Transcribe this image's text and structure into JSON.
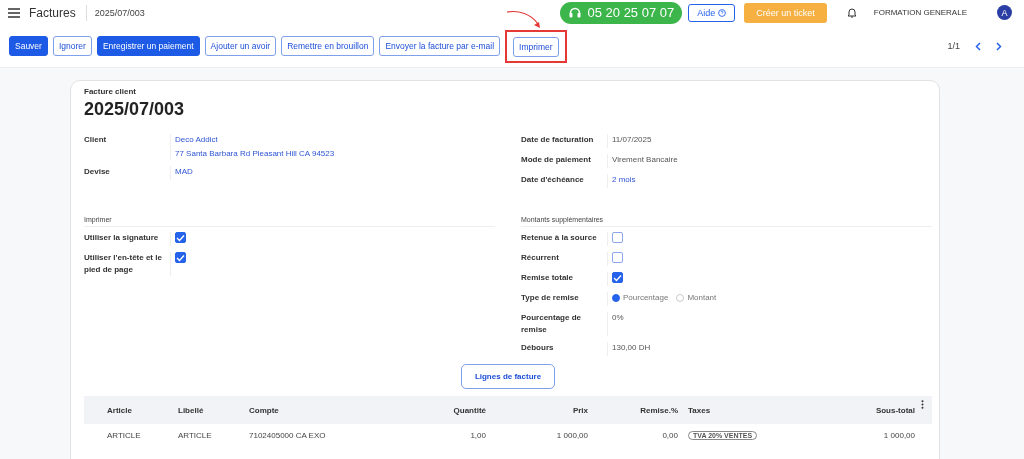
{
  "header": {
    "app": "Factures",
    "record": "2025/07/003",
    "phone": "05 20 25 07 07",
    "help": "Aide",
    "ticket": "Créer un ticket",
    "company": "FORMATION GENERALE",
    "avatar": "A"
  },
  "actions": [
    {
      "label": "Sauver",
      "primary": true,
      "highlighted": false
    },
    {
      "label": "Ignorer",
      "primary": false,
      "highlighted": false
    },
    {
      "label": "Enregistrer un paiement",
      "primary": true,
      "highlighted": false
    },
    {
      "label": "Ajouter un avoir",
      "primary": false,
      "highlighted": false
    },
    {
      "label": "Remettre en brouillon",
      "primary": false,
      "highlighted": false
    },
    {
      "label": "Envoyer la facture par e-mail",
      "primary": false,
      "highlighted": false
    },
    {
      "label": "Imprimer",
      "primary": false,
      "highlighted": true
    }
  ],
  "pager": "1/1",
  "form": {
    "subtitle": "Facture client",
    "title": "2025/07/003",
    "left_fields": [
      {
        "label": "Client",
        "values": [
          "Deco Addict",
          "77 Santa Barbara Rd Pleasant Hill CA 94523"
        ],
        "link": true
      },
      {
        "label": "Devise",
        "values": [
          "MAD"
        ],
        "link": true
      }
    ],
    "right_fields": [
      {
        "label": "Date de facturation",
        "values": [
          "11/07/2025"
        ],
        "link": false
      },
      {
        "label": "Mode de paiement",
        "values": [
          "Virement Bancaire"
        ],
        "link": false
      },
      {
        "label": "Date d'échéance",
        "values": [
          "2 mois"
        ],
        "link": true
      }
    ],
    "print_section": {
      "title": "Imprimer",
      "rows": [
        {
          "label": "Utiliser la signature",
          "kind": "checkbox",
          "checked": true
        },
        {
          "label": "Utiliser l'en-tête et le pied de page",
          "kind": "checkbox",
          "checked": true
        }
      ]
    },
    "amounts_section": {
      "title": "Montants supplémentaires",
      "rows": [
        {
          "label": "Retenue à la source",
          "kind": "checkbox",
          "checked": false
        },
        {
          "label": "Récurrent",
          "kind": "checkbox",
          "checked": false
        },
        {
          "label": "Remise totale",
          "kind": "checkbox",
          "checked": true
        },
        {
          "label": "Type de remise",
          "kind": "radio",
          "options": [
            {
              "label": "Pourcentage",
              "selected": true
            },
            {
              "label": "Montant",
              "selected": false
            }
          ]
        },
        {
          "label": "Pourcentage de remise",
          "kind": "text",
          "value": "0%"
        },
        {
          "label": "Débours",
          "kind": "text",
          "value": "130,00 DH"
        }
      ]
    },
    "lines_button": "Lignes de facture",
    "table": {
      "columns": [
        {
          "label": "Article"
        },
        {
          "label": "Libellé"
        },
        {
          "label": "Compte"
        },
        {
          "label": "Quantité"
        },
        {
          "label": "Prix"
        },
        {
          "label": "Remise.%"
        },
        {
          "label": "Taxes"
        },
        {
          "label": "Sous-total"
        }
      ],
      "rows": [
        {
          "cells": [
            {
              "kind": "text",
              "text": "ARTICLE"
            },
            {
              "kind": "text",
              "text": "ARTICLE"
            },
            {
              "kind": "text",
              "text": "7102405000 CA EXO"
            },
            {
              "kind": "text",
              "text": "1,00"
            },
            {
              "kind": "text",
              "text": "1 000,00"
            },
            {
              "kind": "text",
              "text": "0,00"
            },
            {
              "kind": "tag",
              "text": "TVA 20% VENTES"
            },
            {
              "kind": "text",
              "text": "1 000,00"
            }
          ]
        }
      ]
    }
  }
}
